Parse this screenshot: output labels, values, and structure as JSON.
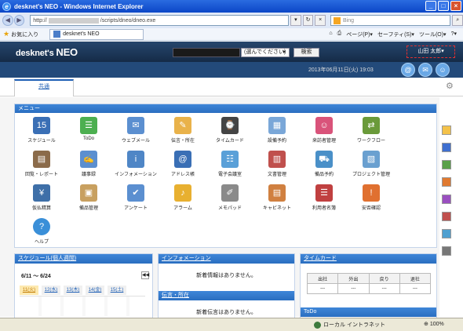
{
  "window": {
    "title": "desknet's NEO - Windows Internet Explorer",
    "minimize": "_",
    "maximize": "□",
    "close": "×"
  },
  "address": {
    "url_prefix": "http://",
    "url_suffix": "/scripts/dneo/dneo.exe",
    "search_placeholder": "Bing"
  },
  "favbar": {
    "favorites_label": "お気に入り",
    "tab_title": "desknet's NEO",
    "tools": [
      "ページ(P)▾",
      "セーフティ(S)▾",
      "ツール(O)▾",
      "?▾"
    ]
  },
  "header": {
    "logo_prefix": "desknet's",
    "logo_suffix": "NEO",
    "search_select": "(選んでください)",
    "search_button": "検索",
    "user_name": "山田 太郎▾",
    "datetime": "2013年06月11日(火) 19:03"
  },
  "tabs": {
    "common": "共通"
  },
  "menu": {
    "title": "メニュー",
    "items": [
      {
        "label": "スケジュール",
        "icon": "calendar-icon",
        "glyph": "15",
        "color": "#3a6fb5"
      },
      {
        "label": "ToDo",
        "icon": "todo-icon",
        "glyph": "☰",
        "color": "#4caf50"
      },
      {
        "label": "ウェブメール",
        "icon": "mail-icon",
        "glyph": "✉",
        "color": "#5b8fd0"
      },
      {
        "label": "伝言・所在",
        "icon": "memo-icon",
        "glyph": "✎",
        "color": "#e9b24a"
      },
      {
        "label": "タイムカード",
        "icon": "timecard-icon",
        "glyph": "⌚",
        "color": "#444444"
      },
      {
        "label": "設備予約",
        "icon": "facility-icon",
        "glyph": "▦",
        "color": "#7aa7d8"
      },
      {
        "label": "来訪者管理",
        "icon": "visitor-icon",
        "glyph": "☺",
        "color": "#d9537a"
      },
      {
        "label": "ワークフロー",
        "icon": "workflow-icon",
        "glyph": "⇄",
        "color": "#6a9a3a"
      },
      {
        "label": "回覧・レポート",
        "icon": "circular-icon",
        "glyph": "▤",
        "color": "#8b6b4a"
      },
      {
        "label": "議事録",
        "icon": "minutes-icon",
        "glyph": "✍",
        "color": "#5b8fd0"
      },
      {
        "label": "インフォメーション",
        "icon": "information-icon",
        "glyph": "i",
        "color": "#4f86c6"
      },
      {
        "label": "アドレス帳",
        "icon": "addressbook-icon",
        "glyph": "@",
        "color": "#3a6fb5"
      },
      {
        "label": "電子会議室",
        "icon": "conference-icon",
        "glyph": "☷",
        "color": "#5aa0d8"
      },
      {
        "label": "文書管理",
        "icon": "documents-icon",
        "glyph": "▥",
        "color": "#c0504d"
      },
      {
        "label": "備品予約",
        "icon": "equipment-icon",
        "glyph": "⛟",
        "color": "#4a90c8"
      },
      {
        "label": "プロジェクト管理",
        "icon": "project-icon",
        "glyph": "▧",
        "color": "#6aa0d0"
      },
      {
        "label": "仮払精算",
        "icon": "expense-icon",
        "glyph": "¥",
        "color": "#3e6fa8"
      },
      {
        "label": "備品管理",
        "icon": "inventory-icon",
        "glyph": "▣",
        "color": "#c8a060"
      },
      {
        "label": "アンケート",
        "icon": "survey-icon",
        "glyph": "✔",
        "color": "#5b8fd0"
      },
      {
        "label": "アラーム",
        "icon": "alarm-icon",
        "glyph": "♪",
        "color": "#e8b030"
      },
      {
        "label": "メモパッド",
        "icon": "memopad-icon",
        "glyph": "✐",
        "color": "#8a8a8a"
      },
      {
        "label": "キャビネット",
        "icon": "cabinet-icon",
        "glyph": "▤",
        "color": "#d08040"
      },
      {
        "label": "利用者名簿",
        "icon": "userlist-icon",
        "glyph": "☰",
        "color": "#c04040"
      },
      {
        "label": "安否確認",
        "icon": "safety-icon",
        "glyph": "!",
        "color": "#e07030"
      },
      {
        "label": "ヘルプ",
        "icon": "help-icon",
        "glyph": "?",
        "color": "#3a8fd8"
      }
    ]
  },
  "schedule": {
    "title": "スケジュール(個人週間)",
    "range": "6/11 ～ 6/24",
    "prev": "◀◀",
    "days": [
      "11(火)",
      "12(水)",
      "13(木)",
      "14(金)",
      "15(土)"
    ]
  },
  "information": {
    "title": "インフォメーション",
    "empty": "新着情報はありません。"
  },
  "messages": {
    "title": "伝言・所在",
    "empty": "新着伝言はありません。"
  },
  "timecard": {
    "title": "タイムカード",
    "headers": [
      "出社",
      "外出",
      "戻り",
      "退社"
    ],
    "values": [
      "---",
      "---",
      "---",
      "---"
    ]
  },
  "todo": {
    "title": "ToDo"
  },
  "palette_colors": [
    "#f4c24a",
    "#3f6fd0",
    "#5aa04a",
    "#e07a30",
    "#9a4fc0",
    "#c0504d",
    "#4fa0d0",
    "#777777"
  ],
  "status": {
    "zone": "ローカル イントラネット",
    "zoom": "100%"
  }
}
